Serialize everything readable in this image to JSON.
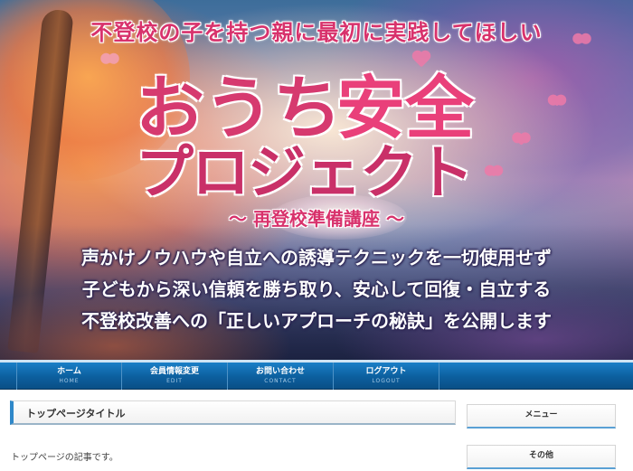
{
  "hero": {
    "tagline": "不登校の子を持つ親に最初に実践してほしい",
    "title_part1": "おうち",
    "title_part2": "安全",
    "title_line2": "プロジェクト",
    "subtitle": "〜 再登校準備講座 〜",
    "lines": [
      "声かけノウハウや自立への誘導テクニックを一切使用せず",
      "子どもから深い信頼を勝ち取り、安心して回復・自立する",
      "不登校改善への「正しいアプローチの秘訣」を公開します"
    ]
  },
  "nav": {
    "items": [
      {
        "label": "ホーム",
        "sub": "HOME"
      },
      {
        "label": "会員情報変更",
        "sub": "EDIT"
      },
      {
        "label": "お問い合わせ",
        "sub": "CONTACT"
      },
      {
        "label": "ログアウト",
        "sub": "LOGOUT"
      }
    ]
  },
  "main": {
    "page_title": "トップページタイトル",
    "article_text": "トップページの記事です。"
  },
  "sidebar": {
    "menu_title": "メニュー",
    "other_title": "その他"
  },
  "colors": {
    "accent_pink": "#d8326c",
    "nav_blue": "#0c5f9e"
  }
}
